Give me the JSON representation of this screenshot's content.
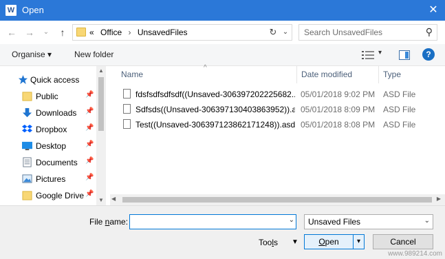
{
  "window": {
    "title": "Open",
    "app_icon": "W",
    "close_glyph": "✕"
  },
  "nav": {
    "back_glyph": "←",
    "forward_glyph": "→",
    "recent_glyph": "⌄",
    "up_glyph": "↑",
    "address": {
      "overflow": "«",
      "segments": [
        "Office",
        "UnsavedFiles"
      ],
      "separator": "›",
      "refresh_glyph": "↻",
      "dropdown_glyph": "⌄"
    },
    "search_placeholder": "Search UnsavedFiles",
    "search_glyph": "⚲"
  },
  "toolbar": {
    "organise": "Organise ▾",
    "new_folder": "New folder",
    "view_dd": "▾",
    "help": "?"
  },
  "sidebar": {
    "items": [
      {
        "label": "Quick access",
        "icon": "star-icon",
        "pinned": false
      },
      {
        "label": "Public",
        "icon": "folder-icon",
        "pinned": true
      },
      {
        "label": "Downloads",
        "icon": "download-icon",
        "pinned": true
      },
      {
        "label": "Dropbox",
        "icon": "dropbox-icon",
        "pinned": true
      },
      {
        "label": "Desktop",
        "icon": "desktop-icon",
        "pinned": true
      },
      {
        "label": "Documents",
        "icon": "documents-icon",
        "pinned": true
      },
      {
        "label": "Pictures",
        "icon": "pictures-icon",
        "pinned": true
      },
      {
        "label": "Google Drive",
        "icon": "folder-icon",
        "pinned": true
      }
    ],
    "pin_glyph": "📌"
  },
  "files": {
    "columns": {
      "name": "Name",
      "date": "Date modified",
      "type": "Type"
    },
    "rows": [
      {
        "name": "fdsfsdfsdfsdf((Unsaved-306397202225682...",
        "date": "05/01/2018 9:02 PM",
        "type": "ASD File"
      },
      {
        "name": "Sdfsds((Unsaved-306397130403863952)).a...",
        "date": "05/01/2018 8:09 PM",
        "type": "ASD File"
      },
      {
        "name": "Test((Unsaved-306397123862171248)).asd",
        "date": "05/01/2018 8:08 PM",
        "type": "ASD File"
      }
    ]
  },
  "bottom": {
    "filename_label_pre": "File ",
    "filename_label_u": "n",
    "filename_label_post": "ame:",
    "filename_value": "",
    "filetype": "Unsaved Files",
    "tools_pre": "Too",
    "tools_u": "l",
    "tools_post": "s",
    "open_u": "O",
    "open_post": "pen",
    "cancel": "Cancel"
  },
  "watermark": "www.989214.com",
  "colors": {
    "titlebar": "#2b78d8",
    "accent": "#0078d7"
  }
}
